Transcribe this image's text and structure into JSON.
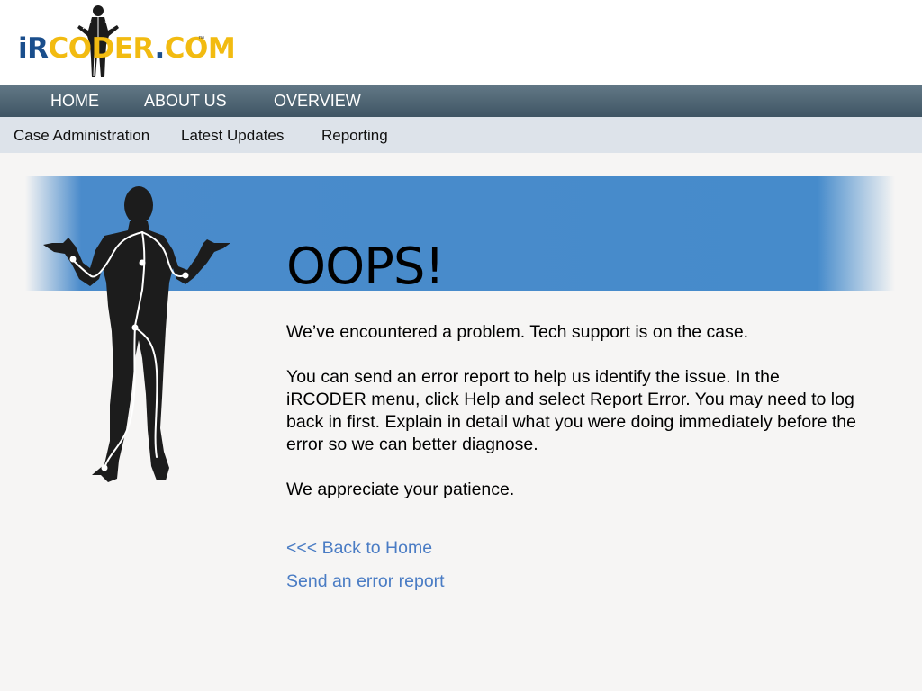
{
  "logo": {
    "ir": "iR",
    "coder": "CODER",
    "dot": ".",
    "com": "COM",
    "tm": "™",
    "figure_icon": "human-figure-icon"
  },
  "topnav": {
    "items": [
      {
        "label": "HOME"
      },
      {
        "label": "ABOUT US"
      },
      {
        "label": "OVERVIEW"
      }
    ]
  },
  "subnav": {
    "items": [
      {
        "label": "Case Administration"
      },
      {
        "label": "Latest Updates"
      },
      {
        "label": "Reporting"
      }
    ]
  },
  "error": {
    "title": "OOPS!",
    "illustration": "shrugging-human-figure-icon",
    "paragraphs": [
      "We’ve encountered a problem. Tech support is on the case.",
      "You can send an error report to help us identify the issue. In the iRCODER menu, click Help and select Report Error. You may need to log back in first. Explain in detail what you were doing immediately before the error so we can better diagnose.",
      "We appreciate your patience."
    ],
    "links": {
      "back_home": "<<< Back to Home",
      "send_report": "Send an error report"
    }
  },
  "colors": {
    "banner": "#4a8bcb",
    "link": "#4a7cc4",
    "topnav": "#4f6574",
    "subnav": "#dde3ea",
    "logo_blue": "#1a4e8c",
    "logo_yellow": "#f2bb11"
  }
}
